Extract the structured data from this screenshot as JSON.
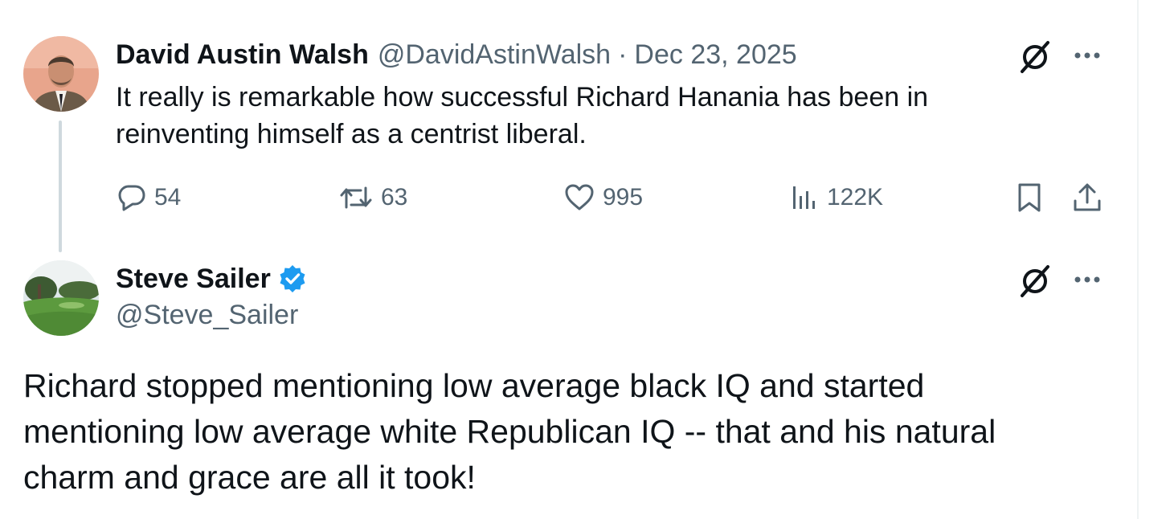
{
  "parent_tweet": {
    "author_name": "David Austin Walsh",
    "handle": "@DavidAstinWalsh",
    "separator": "·",
    "date": "Dec 23, 2025",
    "text_lines": [
      "It really is remarkable how successful Richard Hanania has been in",
      "reinventing himself as a centrist liberal."
    ],
    "metrics": {
      "replies": "54",
      "reposts": "63",
      "likes": "995",
      "views": "122K"
    },
    "icons": [
      "reply-icon",
      "repost-icon",
      "like-icon",
      "views-icon",
      "bookmark-icon",
      "share-icon",
      "grok-icon",
      "more-icon"
    ]
  },
  "reply_tweet": {
    "author_name": "Steve Sailer",
    "verified": true,
    "handle": "@Steve_Sailer",
    "text_lines": [
      "Richard stopped mentioning low average black IQ and started",
      "mentioning low average white Republican IQ -- that and his natural",
      "charm and grace are all it took!"
    ],
    "icons": [
      "verified-badge-icon",
      "grok-icon",
      "more-icon"
    ]
  },
  "colors": {
    "primary_text": "#0f1419",
    "secondary_text": "#536471",
    "verified_blue": "#1d9bf0",
    "thread_line": "#cfd9de"
  }
}
